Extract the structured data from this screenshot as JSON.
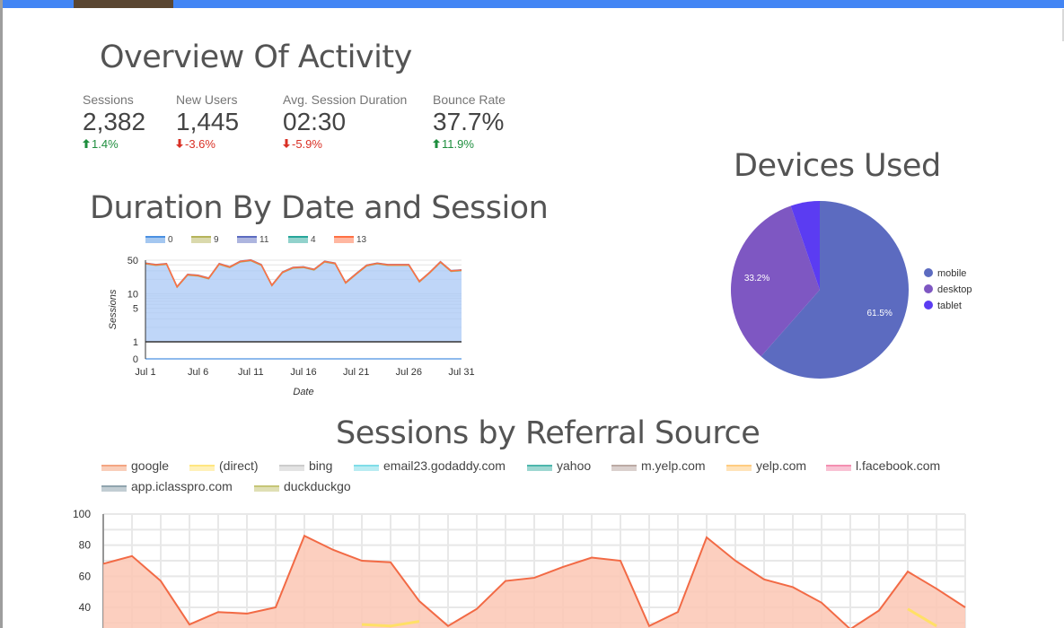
{
  "overview": {
    "title": "Overview Of Activity",
    "kpis": [
      {
        "label": "Sessions",
        "value": "2,382",
        "delta": "1.4%",
        "direction": "up"
      },
      {
        "label": "New Users",
        "value": "1,445",
        "delta": "-3.6%",
        "direction": "down"
      },
      {
        "label": "Avg. Session Duration",
        "value": "02:30",
        "delta": "-5.9%",
        "direction": "down"
      },
      {
        "label": "Bounce Rate",
        "value": "37.7%",
        "delta": "11.9%",
        "direction": "up"
      }
    ]
  },
  "colors": {
    "topbar": "#4285f4",
    "up": "#1e8e3e",
    "down": "#d93025"
  },
  "chart_data": [
    {
      "type": "area",
      "title": "Duration By Date and Session",
      "xlabel": "Date",
      "ylabel": "Sessions",
      "scale": "log",
      "yticks": [
        "0",
        "1",
        "5",
        "10",
        "50"
      ],
      "xticks": [
        "Jul 1",
        "Jul 6",
        "Jul 11",
        "Jul 16",
        "Jul 21",
        "Jul 26",
        "Jul 31"
      ],
      "legend": [
        "0",
        "9",
        "11",
        "4",
        "13"
      ],
      "legend_position": "top",
      "series_colors": [
        "#4a90e2",
        "#b5b35a",
        "#5c6bc0",
        "#26a69a",
        "#ff7043"
      ],
      "x": [
        1,
        2,
        3,
        4,
        5,
        6,
        7,
        8,
        9,
        10,
        11,
        12,
        13,
        14,
        15,
        16,
        17,
        18,
        19,
        20,
        21,
        22,
        23,
        24,
        25,
        26,
        27,
        28,
        29,
        30,
        31
      ],
      "values": [
        43,
        40,
        42,
        14,
        25,
        24,
        21,
        42,
        36,
        47,
        50,
        40,
        15,
        28,
        35,
        36,
        32,
        47,
        43,
        17,
        26,
        39,
        43,
        40,
        40,
        40,
        18,
        28,
        46,
        30,
        31
      ]
    },
    {
      "type": "pie",
      "title": "Devices Used",
      "legend_position": "right",
      "slices": [
        {
          "label": "mobile",
          "value": 61.5,
          "display": "61.5%",
          "color": "#5c6bc0"
        },
        {
          "label": "desktop",
          "value": 33.2,
          "display": "33.2%",
          "color": "#7e57c2"
        },
        {
          "label": "tablet",
          "value": 5.3,
          "display": "",
          "color": "#5b3cf2"
        }
      ]
    },
    {
      "type": "area",
      "title": "Sessions by Referral Source",
      "legend_position": "top",
      "legend": [
        {
          "name": "google",
          "color": "#f4a582"
        },
        {
          "name": "(direct)",
          "color": "#ffe680"
        },
        {
          "name": "bing",
          "color": "#cccccc"
        },
        {
          "name": "email23.godaddy.com",
          "color": "#7fdde8"
        },
        {
          "name": "yahoo",
          "color": "#4db6ac"
        },
        {
          "name": "m.yelp.com",
          "color": "#bcaaa4"
        },
        {
          "name": "yelp.com",
          "color": "#ffcc80"
        },
        {
          "name": "l.facebook.com",
          "color": "#f48fb1"
        },
        {
          "name": "app.iclasspro.com",
          "color": "#90a4ae"
        },
        {
          "name": "duckduckgo",
          "color": "#c5c576"
        }
      ],
      "yticks": [
        "40",
        "60",
        "80",
        "100"
      ],
      "ylim": [
        20,
        100
      ],
      "grid": true,
      "series": [
        {
          "name": "google",
          "values": [
            68,
            73,
            57,
            29,
            37,
            36,
            40,
            86,
            77,
            70,
            69,
            44,
            28,
            39,
            57,
            59,
            66,
            72,
            70,
            28,
            37,
            85,
            70,
            58,
            53,
            43,
            26,
            38,
            63,
            52,
            40
          ]
        },
        {
          "name": "(direct)",
          "values": [
            null,
            null,
            null,
            null,
            null,
            null,
            null,
            null,
            null,
            29,
            28,
            31,
            null,
            null,
            null,
            null,
            null,
            null,
            null,
            null,
            null,
            null,
            null,
            null,
            null,
            null,
            null,
            null,
            39,
            28,
            null
          ]
        }
      ]
    }
  ]
}
